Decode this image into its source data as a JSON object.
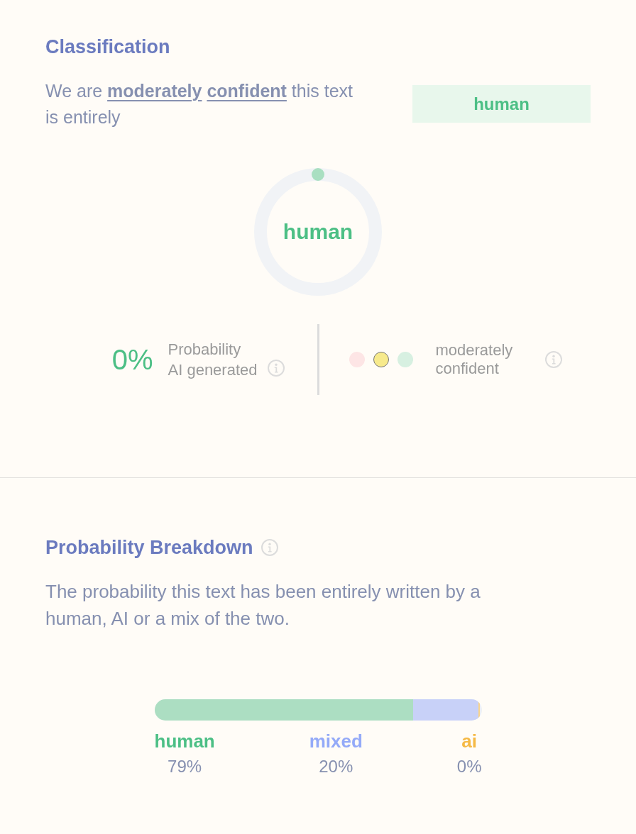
{
  "classification": {
    "heading": "Classification",
    "summary": "We are **moderately** **confident** this text is entirely",
    "badge": "human",
    "gauge": {
      "label": "human"
    },
    "ai_probability": {
      "value": "0%",
      "label": "Probability\nAI generated"
    },
    "confidence": {
      "dots": [
        {
          "color": "#fde5e5",
          "selected": false
        },
        {
          "color": "#f7ea8c",
          "selected": true
        },
        {
          "color": "#d7f0e1",
          "selected": false
        }
      ],
      "label": "moderately confident"
    }
  },
  "breakdown": {
    "heading": "Probability Breakdown",
    "description": "The probability this text has been entirely written by a human, AI or a mix of the two.",
    "bar": {
      "segments": [
        {
          "level": 0.79,
          "color": "#acdec2"
        },
        {
          "level": 0.2,
          "color": "#c8d1f8"
        },
        {
          "level": 0.005,
          "color": "#f8d48c"
        }
      ]
    },
    "items": [
      {
        "label": "human",
        "value": "79%",
        "color": "#4cbf85"
      },
      {
        "label": "mixed",
        "value": "20%",
        "color": "#94aaf8"
      },
      {
        "label": "ai",
        "value": "0%",
        "color": "#f5b945"
      }
    ]
  }
}
